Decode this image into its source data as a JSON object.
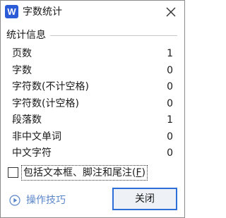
{
  "window": {
    "title": "字数统计",
    "app_icon_letter": "W",
    "app_icon_color": "#2b5bd7"
  },
  "stats_section": {
    "label": "统计信息",
    "rows": [
      {
        "label": "页数",
        "value": "1"
      },
      {
        "label": "字数",
        "value": "0"
      },
      {
        "label": "字符数(不计空格)",
        "value": "0"
      },
      {
        "label": "字符数(计空格)",
        "value": "0"
      },
      {
        "label": "段落数",
        "value": "1"
      },
      {
        "label": "非中文单词",
        "value": "0"
      },
      {
        "label": "中文字符",
        "value": "0"
      }
    ]
  },
  "include_option": {
    "label_main": "包括文本框、脚注和尾注(",
    "mnemonic": "F",
    "label_end": ")",
    "checked": false
  },
  "footer": {
    "tips_label": "操作技巧",
    "close_label": "关闭",
    "accent_color": "#2d6fd6",
    "link_color": "#5a86c8"
  }
}
